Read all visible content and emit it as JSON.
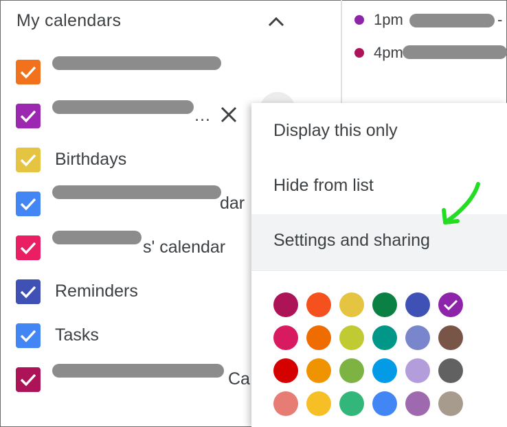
{
  "calendars": {
    "header": "My calendars",
    "items": [
      {
        "label": "",
        "color": "#f2711c"
      },
      {
        "label": "…",
        "color": "#9c27b0"
      },
      {
        "label": "Birthdays",
        "color": "#e4c441"
      },
      {
        "label": "dar",
        "color": "#4285f4"
      },
      {
        "label": "s' calendar",
        "color": "#e91e63"
      },
      {
        "label": "Reminders",
        "color": "#3f51b5"
      },
      {
        "label": "Tasks",
        "color": "#4285f4"
      },
      {
        "label": "Ca",
        "color": "#ad1457"
      }
    ]
  },
  "events": [
    {
      "time": "1pm",
      "suffix": "-",
      "color": "#8e24aa"
    },
    {
      "time": "4pm",
      "suffix": "",
      "color": "#ad1457"
    }
  ],
  "menu": {
    "items": [
      "Display this only",
      "Hide from list",
      "Settings and sharing"
    ],
    "highlighted": "Settings and sharing"
  },
  "palette": {
    "selected": "#8e24aa",
    "colors": [
      [
        "#ad1457",
        "#f4511e",
        "#e4c441",
        "#0b8043",
        "#3f51b5",
        "#8e24aa"
      ],
      [
        "#d81b60",
        "#ef6c00",
        "#c0ca33",
        "#009688",
        "#7986cb",
        "#795548"
      ],
      [
        "#d50000",
        "#f09300",
        "#7cb342",
        "#039be5",
        "#b39ddb",
        "#616161"
      ],
      [
        "#e67c73",
        "#f6bf26",
        "#33b679",
        "#4285f4",
        "#9e69af",
        "#a79b8e"
      ]
    ]
  },
  "annotation": {
    "color": "#22dd22"
  }
}
